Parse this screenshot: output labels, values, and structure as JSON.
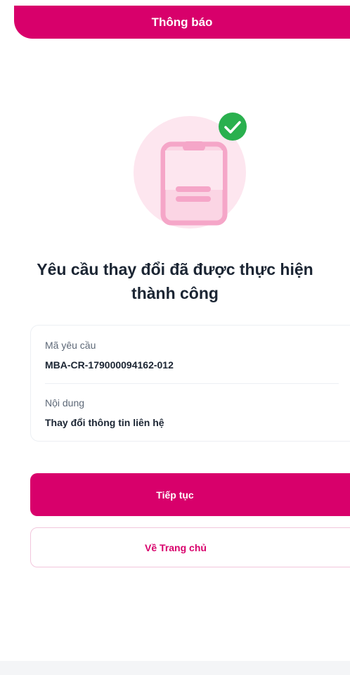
{
  "header": {
    "title": "Thông báo"
  },
  "illustration": {
    "icon": "phone-success-icon",
    "badge_icon": "check-circle-icon",
    "colors": {
      "circle": "#fde6ef",
      "phone": "#f5a6c8",
      "badge": "#2ab04e"
    }
  },
  "result": {
    "title": "Yêu cầu thay đổi đã được thực hiện thành công"
  },
  "details": {
    "request_code_label": "Mã yêu cầu",
    "request_code_value": "MBA-CR-179000094162-012",
    "content_label": "Nội dung",
    "content_value": "Thay đổi thông tin liên hệ"
  },
  "actions": {
    "continue_label": "Tiếp tục",
    "home_label": "Về Trang chủ"
  },
  "colors": {
    "brand": "#d8006b",
    "text_dark": "#1b2533",
    "text_muted": "#5d6877"
  }
}
